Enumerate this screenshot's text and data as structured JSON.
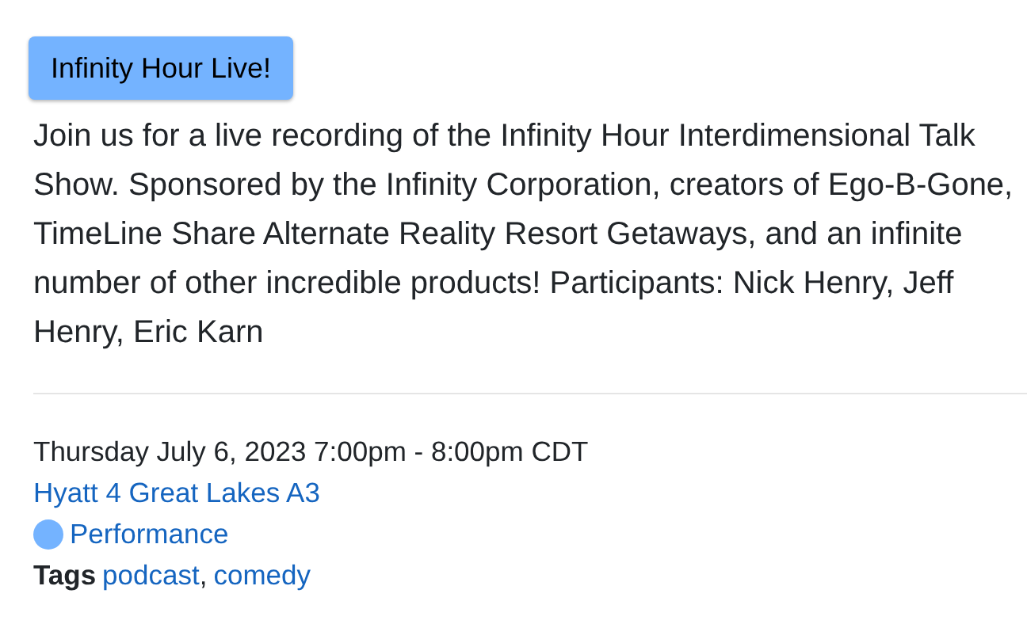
{
  "title_badge": "Infinity Hour Live!",
  "description": "Join us for a live recording of the Infinity Hour Interdimensional Talk Show. Sponsored by the Infinity Corporation, creators of Ego-B-Gone, TimeLine Share Alternate Reality Resort Getaways, and an infinite number of other incredible products! Participants: Nick Henry, Jeff Henry, Eric Karn",
  "datetime": "Thursday July 6, 2023 7:00pm - 8:00pm CDT",
  "location": "Hyatt 4 Great Lakes A3",
  "category": {
    "label": "Performance",
    "color": "#74b3ff"
  },
  "tags": {
    "label": "Tags",
    "items": [
      "podcast",
      "comedy"
    ],
    "separator": ","
  }
}
